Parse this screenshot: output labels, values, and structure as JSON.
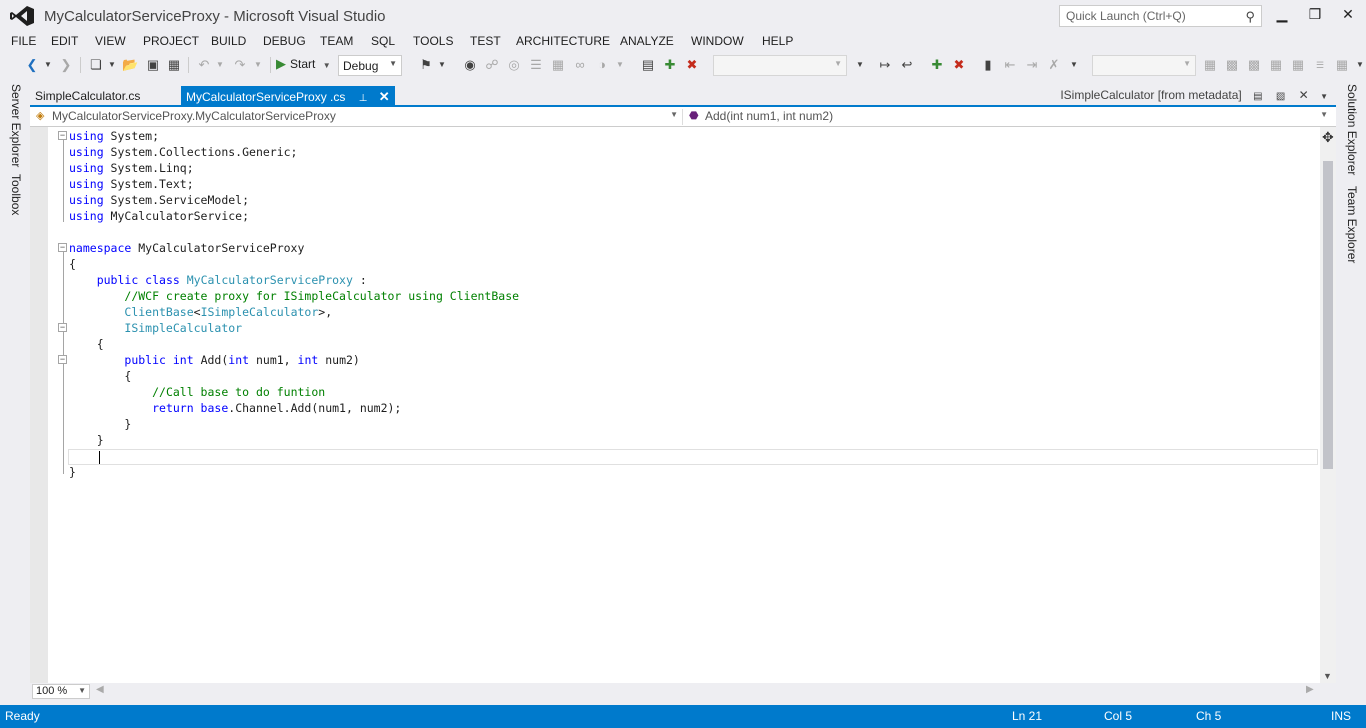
{
  "window": {
    "title": "MyCalculatorServiceProxy - Microsoft Visual Studio",
    "quick_launch_placeholder": "Quick Launch (Ctrl+Q)",
    "minimize": "▁",
    "restore": "❒",
    "close": "✕"
  },
  "menu": [
    "FILE",
    "EDIT",
    "VIEW",
    "PROJECT",
    "BUILD",
    "DEBUG",
    "TEAM",
    "SQL",
    "TOOLS",
    "TEST",
    "ARCHITECTURE",
    "ANALYZE",
    "WINDOW",
    "HELP"
  ],
  "toolbar": {
    "start_label": "Start",
    "config_value": "Debug"
  },
  "left_tabs": [
    "Server Explorer",
    "Toolbox"
  ],
  "right_tabs": [
    "Solution Explorer",
    "Team Explorer"
  ],
  "doc_tabs": {
    "tab1": "SimpleCalculator.cs",
    "tab2": "MyCalculatorServiceProxy .cs",
    "preview": "ISimpleCalculator [from metadata]"
  },
  "navbar": {
    "type_combo": "MyCalculatorServiceProxy.MyCalculatorServiceProxy",
    "member_combo": "Add(int num1, int num2)"
  },
  "code_lines": [
    [
      [
        "kw",
        "using"
      ],
      [
        "",
        "System;"
      ]
    ],
    [
      [
        "kw",
        "using"
      ],
      [
        "",
        "System.Collections.Generic;"
      ]
    ],
    [
      [
        "kw",
        "using"
      ],
      [
        "",
        "System.Linq;"
      ]
    ],
    [
      [
        "kw",
        "using"
      ],
      [
        "",
        "System.Text;"
      ]
    ],
    [
      [
        "kw",
        "using"
      ],
      [
        "",
        "System.ServiceModel;"
      ]
    ],
    [
      [
        "kw",
        "using"
      ],
      [
        "",
        "MyCalculatorService;"
      ]
    ],
    [],
    [
      [
        "kw",
        "namespace"
      ],
      [
        "",
        "MyCalculatorServiceProxy"
      ]
    ],
    [
      [
        "",
        "{"
      ]
    ],
    [
      [
        "",
        "    "
      ],
      [
        "kw",
        "public class"
      ],
      [
        "ty",
        "MyCalculatorServiceProxy"
      ],
      [
        "",
        ":"
      ]
    ],
    [
      [
        "",
        "        "
      ],
      [
        "cm",
        "//WCF create proxy for ISimpleCalculator using ClientBase"
      ]
    ],
    [
      [
        "",
        "        "
      ],
      [
        "ty",
        "ClientBase"
      ],
      [
        "",
        "<"
      ],
      [
        "ty",
        "ISimpleCalculator"
      ],
      [
        "",
        ">,"
      ]
    ],
    [
      [
        "",
        "        "
      ],
      [
        "ty",
        "ISimpleCalculator"
      ]
    ],
    [
      [
        "",
        "    {"
      ]
    ],
    [
      [
        "",
        "        "
      ],
      [
        "kw",
        "public int"
      ],
      [
        "",
        "Add("
      ],
      [
        "kw",
        "int"
      ],
      [
        "",
        "num1,"
      ],
      [
        "kw",
        "int"
      ],
      [
        "",
        "num2)"
      ]
    ],
    [
      [
        "",
        "        {"
      ]
    ],
    [
      [
        "",
        "            "
      ],
      [
        "cm",
        "//Call base to do funtion"
      ]
    ],
    [
      [
        "",
        "            "
      ],
      [
        "kw",
        "return base"
      ],
      [
        "",
        ".Channel.Add(num1, num2);"
      ]
    ],
    [
      [
        "",
        "        }"
      ]
    ],
    [
      [
        "",
        "    }"
      ]
    ],
    [],
    [
      [
        "",
        "}"
      ]
    ]
  ],
  "zoom": "100 %",
  "status": {
    "ready": "Ready",
    "line": "Ln 21",
    "col": "Col 5",
    "ch": "Ch 5",
    "mode": "INS"
  }
}
